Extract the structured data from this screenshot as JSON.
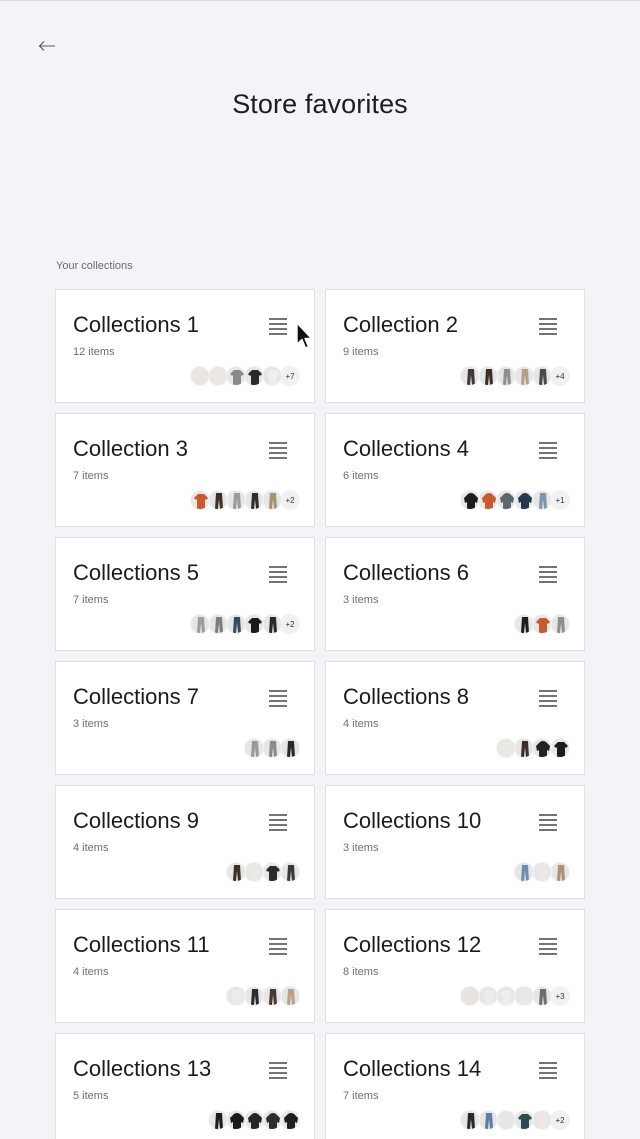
{
  "page": {
    "title": "Store favorites",
    "section_label": "Your collections"
  },
  "icons": {
    "back": "arrow-left-icon",
    "menu": "list-menu-icon",
    "cursor": "mouse-pointer-icon"
  },
  "collections": [
    {
      "title": "Collections 1",
      "count": "12 items",
      "more": "+7",
      "thumbs": [
        [
          "#e9e4dc",
          "shirt"
        ],
        [
          "#ece7e0",
          "shirt"
        ],
        [
          "#8a8a8a",
          "shirt"
        ],
        [
          "#2a2a2a",
          "shirt"
        ],
        [
          "#efefef",
          "shirt"
        ]
      ]
    },
    {
      "title": "Collection 2",
      "count": "9 items",
      "more": "+4",
      "thumbs": [
        [
          "#3f3a35",
          "pants"
        ],
        [
          "#3b2f28",
          "pants"
        ],
        [
          "#8f8f8f",
          "pants"
        ],
        [
          "#b89e84",
          "pants"
        ],
        [
          "#4a4a4a",
          "pants"
        ]
      ]
    },
    {
      "title": "Collection 3",
      "count": "7 items",
      "more": "+2",
      "thumbs": [
        [
          "#c85a32",
          "shirt"
        ],
        [
          "#3b2f28",
          "pants"
        ],
        [
          "#9a9a9a",
          "pants"
        ],
        [
          "#2e2e2e",
          "pants"
        ],
        [
          "#a89276",
          "pants"
        ]
      ]
    },
    {
      "title": "Collections 4",
      "count": "6 items",
      "more": "+1",
      "thumbs": [
        [
          "#1c1c1c",
          "hoodie"
        ],
        [
          "#c85a32",
          "hoodie"
        ],
        [
          "#5c6770",
          "hoodie"
        ],
        [
          "#24384e",
          "hoodie"
        ],
        [
          "#7c95b3",
          "pants"
        ]
      ]
    },
    {
      "title": "Collections 5",
      "count": "7 items",
      "more": "+2",
      "thumbs": [
        [
          "#9d9d9d",
          "pants"
        ],
        [
          "#7d7d7d",
          "pants"
        ],
        [
          "#3a4a5c",
          "pants"
        ],
        [
          "#1a1a1a",
          "shirt"
        ],
        [
          "#2a2a2a",
          "pants"
        ]
      ]
    },
    {
      "title": "Collections 6",
      "count": "3 items",
      "more": "",
      "thumbs": [
        [
          "#1e1e1e",
          "pants"
        ],
        [
          "#c85a32",
          "shirt"
        ],
        [
          "#8e8e8e",
          "pants"
        ]
      ]
    },
    {
      "title": "Collections 7",
      "count": "3 items",
      "more": "",
      "thumbs": [
        [
          "#9a9a9a",
          "pants"
        ],
        [
          "#8a8a8a",
          "pants"
        ],
        [
          "#2a2a2a",
          "pants"
        ]
      ]
    },
    {
      "title": "Collections 8",
      "count": "4 items",
      "more": "",
      "thumbs": [
        [
          "#ece8e2",
          "shirt"
        ],
        [
          "#3b2f28",
          "pants"
        ],
        [
          "#232323",
          "hoodie"
        ],
        [
          "#1b1b1b",
          "shirt"
        ]
      ]
    },
    {
      "title": "Collections 9",
      "count": "4 items",
      "more": "",
      "thumbs": [
        [
          "#3b2f28",
          "pants"
        ],
        [
          "#ece8e2",
          "shirt"
        ],
        [
          "#2b2b2b",
          "shirt"
        ],
        [
          "#3a3a3a",
          "pants"
        ]
      ]
    },
    {
      "title": "Collections 10",
      "count": "3 items",
      "more": "",
      "thumbs": [
        [
          "#6e8fb4",
          "pants"
        ],
        [
          "#e9e9e9",
          "shirt"
        ],
        [
          "#b08f73",
          "pants"
        ]
      ]
    },
    {
      "title": "Collections 11",
      "count": "4 items",
      "more": "",
      "thumbs": [
        [
          "#ececec",
          "shirt"
        ],
        [
          "#2c2c2c",
          "pants"
        ],
        [
          "#4a3a2c",
          "pants"
        ],
        [
          "#b8a28a",
          "pants"
        ]
      ]
    },
    {
      "title": "Collections 12",
      "count": "8 items",
      "more": "+3",
      "thumbs": [
        [
          "#e8e3dc",
          "shirt"
        ],
        [
          "#ececec",
          "shirt"
        ],
        [
          "#eeeeee",
          "shirt"
        ],
        [
          "#e9e9e9",
          "shirt"
        ],
        [
          "#6e6e6e",
          "pants"
        ]
      ]
    },
    {
      "title": "Collections 13",
      "count": "5 items",
      "more": "",
      "thumbs": [
        [
          "#1c1c1c",
          "pants"
        ],
        [
          "#1a1a1a",
          "hoodie"
        ],
        [
          "#262626",
          "hoodie"
        ],
        [
          "#2c2c2c",
          "hoodie"
        ],
        [
          "#1f1f1f",
          "hoodie"
        ]
      ]
    },
    {
      "title": "Collections 14",
      "count": "7 items",
      "more": "+2",
      "thumbs": [
        [
          "#2a2a2a",
          "pants"
        ],
        [
          "#5f7ea3",
          "pants"
        ],
        [
          "#e6e6e6",
          "shirt"
        ],
        [
          "#2d4a4c",
          "shirt"
        ],
        [
          "#ece8e2",
          "shirt"
        ]
      ]
    }
  ]
}
